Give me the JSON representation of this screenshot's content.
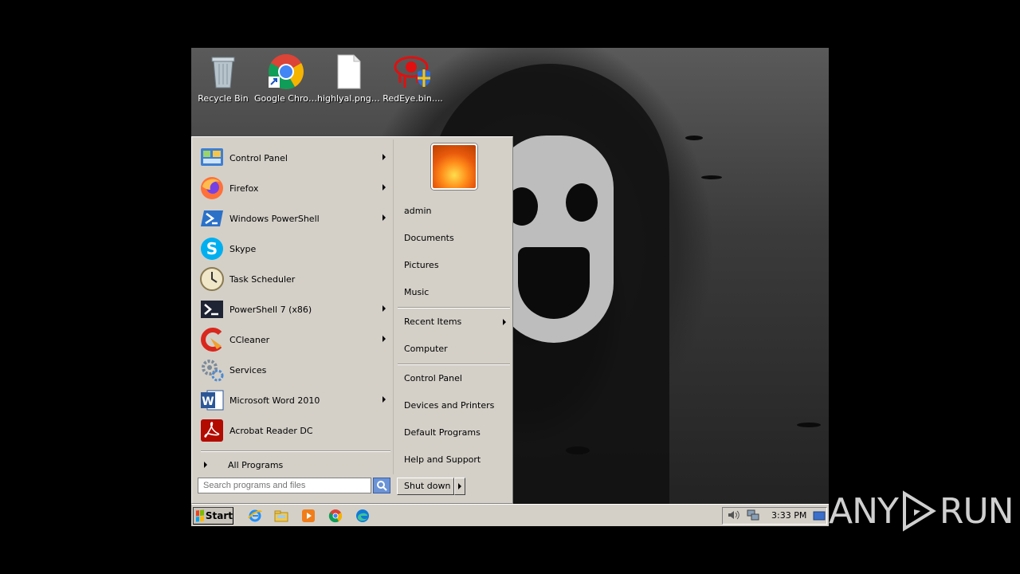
{
  "desktop": {
    "icons": [
      {
        "label": "Recycle Bin",
        "icon": "recycle-bin-icon"
      },
      {
        "label": "Google Chrome",
        "icon": "chrome-icon"
      },
      {
        "label": "highlyal.png....",
        "icon": "file-icon"
      },
      {
        "label": "RedEye.bin....",
        "icon": "redeye-icon"
      }
    ]
  },
  "start_menu": {
    "programs": [
      {
        "label": "Control Panel",
        "icon": "control-panel-icon",
        "submenu": true
      },
      {
        "label": "Firefox",
        "icon": "firefox-icon",
        "submenu": true
      },
      {
        "label": "Windows PowerShell",
        "icon": "powershell-icon",
        "submenu": true
      },
      {
        "label": "Skype",
        "icon": "skype-icon",
        "submenu": false
      },
      {
        "label": "Task Scheduler",
        "icon": "task-scheduler-icon",
        "submenu": false
      },
      {
        "label": "PowerShell 7 (x86)",
        "icon": "powershell7-icon",
        "submenu": true
      },
      {
        "label": "CCleaner",
        "icon": "ccleaner-icon",
        "submenu": true
      },
      {
        "label": "Services",
        "icon": "services-icon",
        "submenu": false
      },
      {
        "label": "Microsoft Word 2010",
        "icon": "word-icon",
        "submenu": true
      },
      {
        "label": "Acrobat Reader DC",
        "icon": "acrobat-icon",
        "submenu": false
      }
    ],
    "all_programs": "All Programs",
    "search_placeholder": "Search programs and files",
    "right_items": [
      {
        "label": "admin",
        "submenu": false
      },
      {
        "label": "Documents",
        "submenu": false
      },
      {
        "label": "Pictures",
        "submenu": false
      },
      {
        "label": "Music",
        "submenu": false
      },
      {
        "label": "Recent Items",
        "submenu": true
      },
      {
        "label": "Computer",
        "submenu": false
      },
      {
        "label": "Control Panel",
        "submenu": false
      },
      {
        "label": "Devices and Printers",
        "submenu": false
      },
      {
        "label": "Default Programs",
        "submenu": false
      },
      {
        "label": "Help and Support",
        "submenu": false
      }
    ],
    "shutdown_label": "Shut down"
  },
  "taskbar": {
    "start_label": "Start",
    "quick_launch": [
      "ie-icon",
      "explorer-icon",
      "media-player-icon",
      "chrome-icon",
      "edge-icon"
    ],
    "tray_icons": [
      "volume-icon",
      "network-icon",
      "show-desktop-icon"
    ],
    "clock": "3:33 PM"
  },
  "watermark": {
    "left": "ANY",
    "right": "RUN"
  }
}
